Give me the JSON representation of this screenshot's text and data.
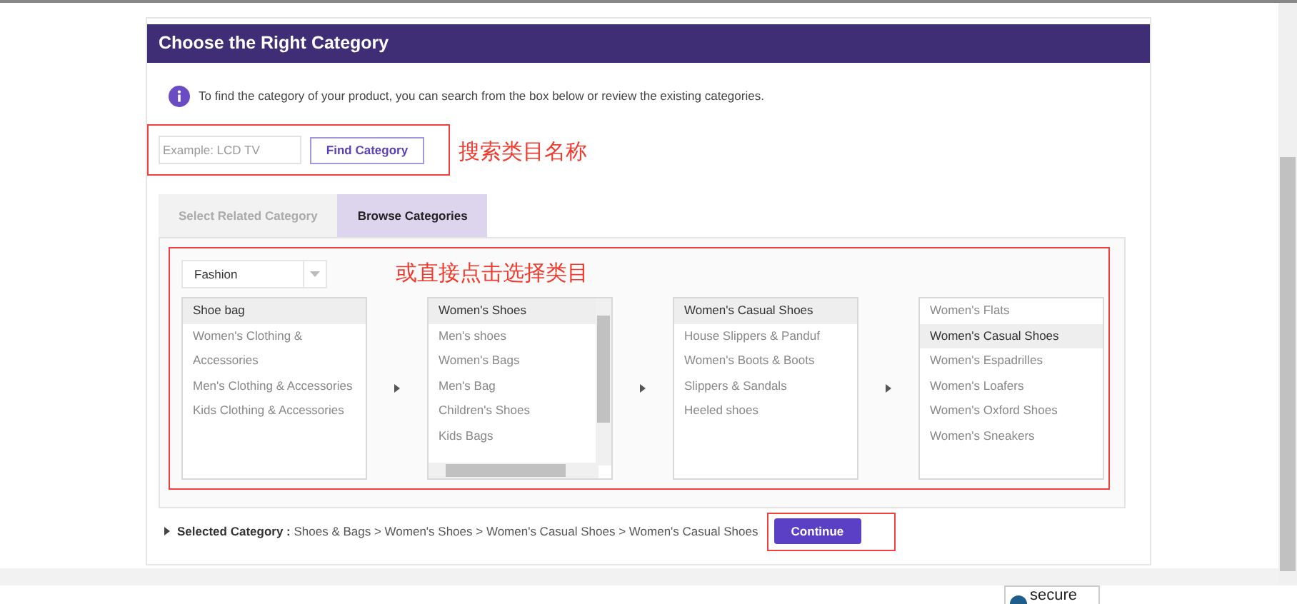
{
  "header": {
    "title": "Choose the Right Category"
  },
  "info": "To find the category of your product, you can search from the box below or review the existing categories.",
  "search": {
    "placeholder": "Example: LCD TV",
    "button": "Find Category"
  },
  "annotations": [
    {
      "text": "搜索类目名称"
    },
    {
      "text": "或直接点击选择类目"
    }
  ],
  "tabs": [
    {
      "label": "Select Related Category",
      "selected": false
    },
    {
      "label": "Browse Categories",
      "selected": true
    }
  ],
  "dropdown": {
    "value": "Fashion"
  },
  "columns": [
    {
      "scrollable": false,
      "items": [
        {
          "label": "Shoe bag",
          "selected": true
        },
        {
          "label": "Women's Clothing & Accessories",
          "selected": false
        },
        {
          "label": "Men's Clothing & Accessories",
          "selected": false
        },
        {
          "label": "Kids Clothing & Accessories",
          "selected": false
        }
      ]
    },
    {
      "scrollable": true,
      "items": [
        {
          "label": "Women's Shoes",
          "selected": true
        },
        {
          "label": "Men's shoes",
          "selected": false
        },
        {
          "label": "Women's Bags",
          "selected": false
        },
        {
          "label": "Men's Bag",
          "selected": false
        },
        {
          "label": "Children's Shoes",
          "selected": false
        },
        {
          "label": "Kids Bags",
          "selected": false
        }
      ]
    },
    {
      "scrollable": false,
      "items": [
        {
          "label": "Women's Casual Shoes",
          "selected": true
        },
        {
          "label": "House Slippers & Panduf",
          "selected": false
        },
        {
          "label": "Women's Boots & Boots",
          "selected": false
        },
        {
          "label": "Slippers & Sandals",
          "selected": false
        },
        {
          "label": "Heeled shoes",
          "selected": false
        }
      ]
    },
    {
      "scrollable": false,
      "items": [
        {
          "label": "Women's Flats",
          "selected": false
        },
        {
          "label": "Women's Casual Shoes",
          "selected": true
        },
        {
          "label": "Women's Espadrilles",
          "selected": false
        },
        {
          "label": "Women's Loafers",
          "selected": false
        },
        {
          "label": "Women's Oxford Shoes",
          "selected": false
        },
        {
          "label": "Women's Sneakers",
          "selected": false
        }
      ]
    }
  ],
  "selected_category": {
    "label": "Selected Category :",
    "path": "Shoes & Bags > Women's Shoes > Women's Casual Shoes > Women's Casual Shoes"
  },
  "continue_button": "Continue",
  "footer_badge": "secure"
}
